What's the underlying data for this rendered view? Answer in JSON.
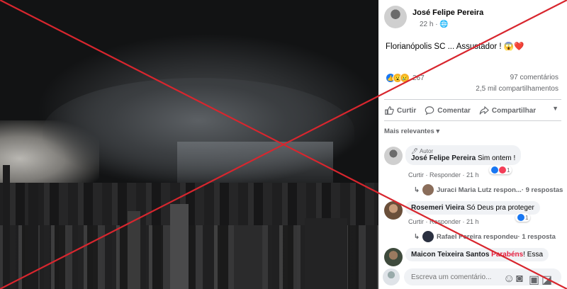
{
  "post": {
    "author": "José Felipe Pereira",
    "time": "22 h · ",
    "text": "Florianópolis   SC ... Assustador ! 😱❤️",
    "reaction_count": "267",
    "comments_count": "97 comentários",
    "shares_count": "2,5 mil compartilhamentos"
  },
  "actions": {
    "like": "Curtir",
    "comment": "Comentar",
    "share": "Compartilhar"
  },
  "filter_label": "Mais relevantes ▾",
  "comments": [
    {
      "author_badge": "🖊 Autor",
      "name": "José Felipe Pereira",
      "text": " Sim ontem !",
      "meta": "Curtir · Responder · 21 h",
      "reaction_count": "1",
      "reply_summary": "Juraci Maria Lutz respon...",
      "reply_count": " · 9 respostas"
    },
    {
      "name": "Rosemeri Vieira",
      "text": " Só Deus pra proteger",
      "meta": "Curtir · Responder · 21 h",
      "reaction_count": "1",
      "reply_summary": "Rafael Pereira respondeu",
      "reply_count": " · 1 resposta"
    },
    {
      "name": "Maicon Teixeira Santos",
      "mention": " Parabéns",
      "text": "! Essa"
    }
  ],
  "composer": {
    "placeholder": "Escreva um comentário..."
  },
  "colors": {
    "accent": "#1877f2",
    "overlay_x": "#d8262e",
    "mention": "#e41e3f"
  }
}
